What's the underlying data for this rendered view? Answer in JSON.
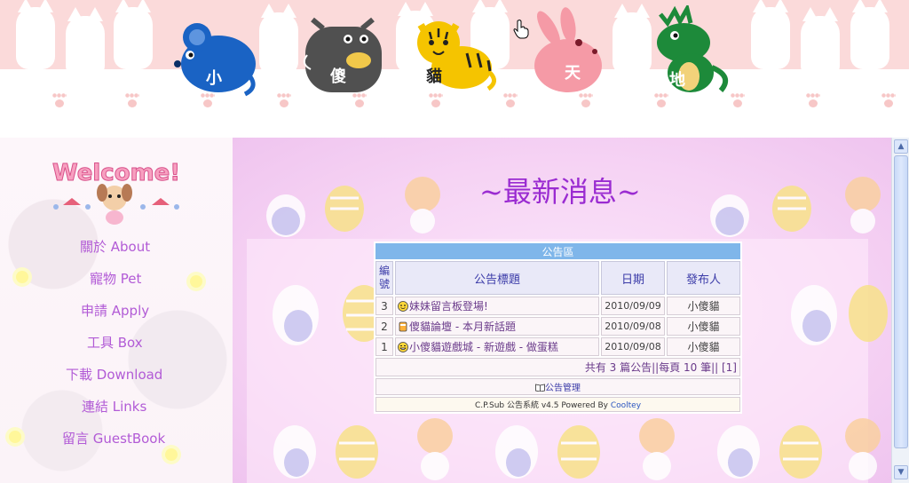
{
  "header": {
    "zodiac": [
      {
        "animal": "rat",
        "label": "小",
        "color": "#1a63c4"
      },
      {
        "animal": "ox",
        "label": "傻",
        "color": "#505050"
      },
      {
        "animal": "tiger",
        "label": "貓",
        "color": "#f5c400"
      },
      {
        "animal": "rabbit",
        "label": "天",
        "color": "#f59aa6"
      },
      {
        "animal": "dragon",
        "label": "地",
        "color": "#1d8a3a"
      }
    ]
  },
  "sidebar": {
    "welcome": "Welcome!!",
    "links": [
      {
        "label": "關於 About"
      },
      {
        "label": "寵物 Pet"
      },
      {
        "label": "申請 Apply"
      },
      {
        "label": "工具 Box"
      },
      {
        "label": "下載 Download"
      },
      {
        "label": "連結 Links"
      },
      {
        "label": "留言 GuestBook"
      }
    ]
  },
  "main": {
    "title": "~最新消息~",
    "board": {
      "header": "公告區",
      "columns": {
        "num": "編號",
        "title": "公告標題",
        "date": "日期",
        "author": "發布人"
      },
      "rows": [
        {
          "num": "3",
          "icon": "smile-icon",
          "title": "妹妹留言板登場!",
          "date": "2010/09/09",
          "author": "小傻貓"
        },
        {
          "num": "2",
          "icon": "drink-icon",
          "title": "傻貓論壇 - 本月新話題",
          "date": "2010/09/08",
          "author": "小傻貓"
        },
        {
          "num": "1",
          "icon": "grin-icon",
          "title": "小傻貓遊戲城 - 新遊戲 - 做蛋糕",
          "date": "2010/09/08",
          "author": "小傻貓"
        }
      ],
      "summary": "共有 3 篇公告||每頁 10 筆|| [1]",
      "admin_label": "公告管理",
      "powered_prefix": "C.P.Sub 公告系統 v4.5 Powered By ",
      "powered_link": "Cooltey"
    }
  },
  "colors": {
    "link": "#b25bd6",
    "title": "#9a2bd1",
    "board_header": "#7fb6ea"
  }
}
